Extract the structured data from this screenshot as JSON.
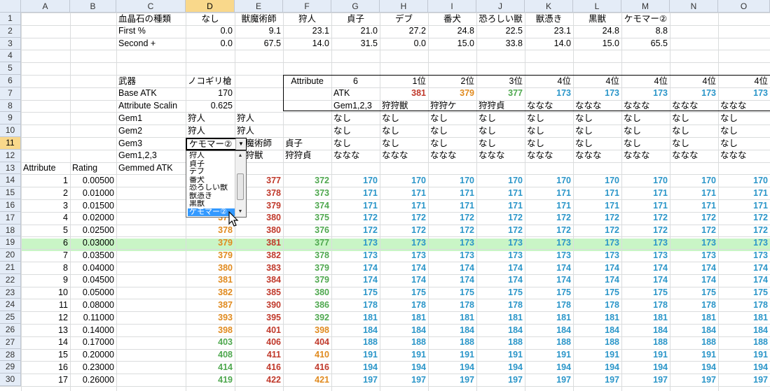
{
  "columns": [
    "A",
    "B",
    "C",
    "D",
    "E",
    "F",
    "G",
    "H",
    "I",
    "J",
    "K",
    "L",
    "M",
    "N",
    "O"
  ],
  "selected_column": "D",
  "selected_row": "11",
  "rows": [
    "1",
    "2",
    "3",
    "4",
    "5",
    "6",
    "7",
    "8",
    "9",
    "10",
    "11",
    "12",
    "13",
    "14",
    "15",
    "16",
    "17",
    "18",
    "19",
    "20",
    "21",
    "22",
    "23",
    "24",
    "25",
    "26",
    "27",
    "28",
    "29",
    "30"
  ],
  "gem_table": {
    "label": "血晶石の種類",
    "first_label": "First %",
    "second_label": "Second +",
    "headers": [
      "なし",
      "獣魔術師",
      "狩人",
      "貞子",
      "デブ",
      "番犬",
      "恐ろしい獣",
      "獣憑き",
      "黒獣",
      "ケモマー②"
    ],
    "first": [
      "0.0",
      "9.1",
      "23.1",
      "21.0",
      "27.2",
      "24.8",
      "22.5",
      "23.1",
      "24.8",
      "8.8"
    ],
    "second": [
      "0.0",
      "67.5",
      "14.0",
      "31.5",
      "0.0",
      "15.0",
      "33.8",
      "14.0",
      "15.0",
      "65.5"
    ]
  },
  "weapon": {
    "weapon_label": "武器",
    "weapon_value": "ノコギリ槍",
    "base_atk_label": "Base ATK",
    "base_atk_value": "170",
    "scaling_label": "Attribute Scalin",
    "scaling_value": "0.625"
  },
  "gems": {
    "gem1_label": "Gem1",
    "gem2_label": "Gem2",
    "gem3_label": "Gem3",
    "gem123_label": "Gem1,2,3",
    "gem1_value": "狩人",
    "gem2_value": "狩人",
    "gem3_value": "ケモマー②",
    "d12_value": "狩人",
    "e_col": [
      "狩人",
      "狩人",
      "獣魔術師",
      "狩狩獣"
    ],
    "f_col": [
      "",
      "",
      "貞子",
      "狩狩貞"
    ]
  },
  "ranking": {
    "attribute_label": "Attribute",
    "attribute_value": "6",
    "atk_label": "ATK",
    "gem123_label": "Gem1,2,3",
    "ranks": [
      "1位",
      "2位",
      "3位",
      "4位",
      "4位",
      "4位",
      "4位",
      "4位"
    ],
    "atk": [
      "381",
      "379",
      "377",
      "173",
      "173",
      "173",
      "173",
      "173"
    ],
    "combos": [
      "狩狩獣",
      "狩狩ケ",
      "狩狩貞",
      "ななな",
      "ななな",
      "ななな",
      "ななな",
      "ななな"
    ],
    "none_label": "なし",
    "combo_none": "ななな"
  },
  "table_header": {
    "attribute": "Attribute",
    "rating": "Rating",
    "gemmed_atk": "Gemmed ATK"
  },
  "attr_rows": [
    {
      "a": "1",
      "b": "0.00500",
      "d": "",
      "e": "377",
      "f": "372",
      "rest": "170"
    },
    {
      "a": "2",
      "b": "0.01000",
      "d": "",
      "e": "378",
      "f": "373",
      "rest": "171"
    },
    {
      "a": "3",
      "b": "0.01500",
      "d": "",
      "e": "379",
      "f": "374",
      "rest": "171"
    },
    {
      "a": "4",
      "b": "0.02000",
      "d": "377",
      "e": "380",
      "f": "375",
      "rest": "172"
    },
    {
      "a": "5",
      "b": "0.02500",
      "d": "378",
      "e": "380",
      "f": "376",
      "rest": "172"
    },
    {
      "a": "6",
      "b": "0.03000",
      "d": "379",
      "e": "381",
      "f": "377",
      "rest": "173"
    },
    {
      "a": "7",
      "b": "0.03500",
      "d": "379",
      "e": "382",
      "f": "378",
      "rest": "173"
    },
    {
      "a": "8",
      "b": "0.04000",
      "d": "380",
      "e": "383",
      "f": "379",
      "rest": "174"
    },
    {
      "a": "9",
      "b": "0.04500",
      "d": "381",
      "e": "384",
      "f": "379",
      "rest": "174"
    },
    {
      "a": "10",
      "b": "0.05000",
      "d": "382",
      "e": "385",
      "f": "380",
      "rest": "175"
    },
    {
      "a": "11",
      "b": "0.08000",
      "d": "387",
      "e": "390",
      "f": "386",
      "rest": "178"
    },
    {
      "a": "12",
      "b": "0.11000",
      "d": "393",
      "e": "395",
      "f": "392",
      "rest": "181"
    },
    {
      "a": "13",
      "b": "0.14000",
      "d": "398",
      "e": "401",
      "f": "398",
      "rest": "184"
    },
    {
      "a": "14",
      "b": "0.17000",
      "d": "403",
      "e": "406",
      "f": "404",
      "rest": "188"
    },
    {
      "a": "15",
      "b": "0.20000",
      "d": "408",
      "e": "411",
      "f": "410",
      "rest": "191"
    },
    {
      "a": "16",
      "b": "0.23000",
      "d": "414",
      "e": "416",
      "f": "416",
      "rest": "194"
    },
    {
      "a": "17",
      "b": "0.26000",
      "d": "419",
      "e": "422",
      "f": "421",
      "rest": "197"
    }
  ],
  "dropdown": {
    "items": [
      "狩人",
      "貞子",
      "デブ",
      "番犬",
      "恐ろしい獣",
      "獣憑き",
      "黒獣",
      "ケモマー②"
    ],
    "selected_index": 7
  },
  "colors": {
    "header_bg": "#e4ecf7",
    "selected_header_bg": "#f9d88b",
    "highlight_row": "#c9f5c6",
    "red": "#c0392b",
    "orange": "#e08a1e",
    "green": "#4fa84f",
    "blue": "#2b96c9"
  }
}
